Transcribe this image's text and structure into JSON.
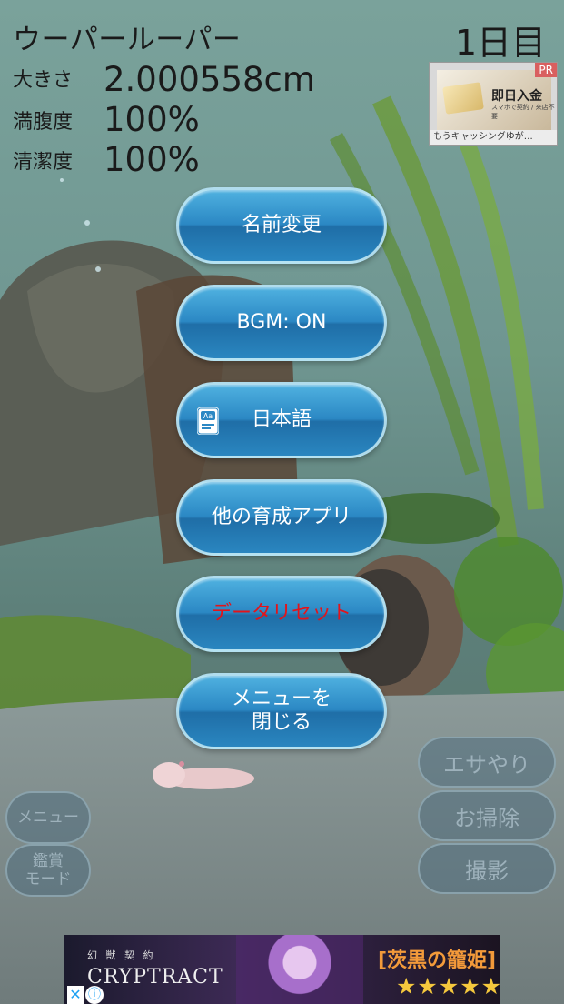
{
  "status": {
    "pet_name": "ウーパールーパー",
    "day": "1日目",
    "size_label": "大きさ",
    "size_value": "2.000558cm",
    "fullness_label": "満腹度",
    "fullness_value": "100%",
    "cleanliness_label": "清潔度",
    "cleanliness_value": "100%"
  },
  "top_ad": {
    "pr_label": "PR",
    "headline": "即日入金",
    "sub": "スマホで契約 / 来店不要",
    "caption": "もうキャッシングゆが…"
  },
  "menu": {
    "rename": "名前変更",
    "bgm": "BGM: ON",
    "language": "日本語",
    "other_apps": "他の育成アプリ",
    "data_reset": "データリセット",
    "close": "メニューを\n閉じる"
  },
  "side_buttons": {
    "menu": "メニュー",
    "viewing_mode": "鑑賞\nモード",
    "feed": "エサやり",
    "clean": "お掃除",
    "photo": "撮影"
  },
  "bottom_ad": {
    "small_title": "幻 獣 契 約",
    "brand": "CRYPTRACT",
    "headline": "[茨黒の籠姫] レム",
    "stars": "★★★★★★"
  },
  "colors": {
    "button_blue": "#2b88c4",
    "reset_text": "#e3141b",
    "text_dark": "#1a1a1a"
  },
  "icons": [
    "language-doc-icon",
    "close-ad-icon",
    "ad-info-icon"
  ]
}
